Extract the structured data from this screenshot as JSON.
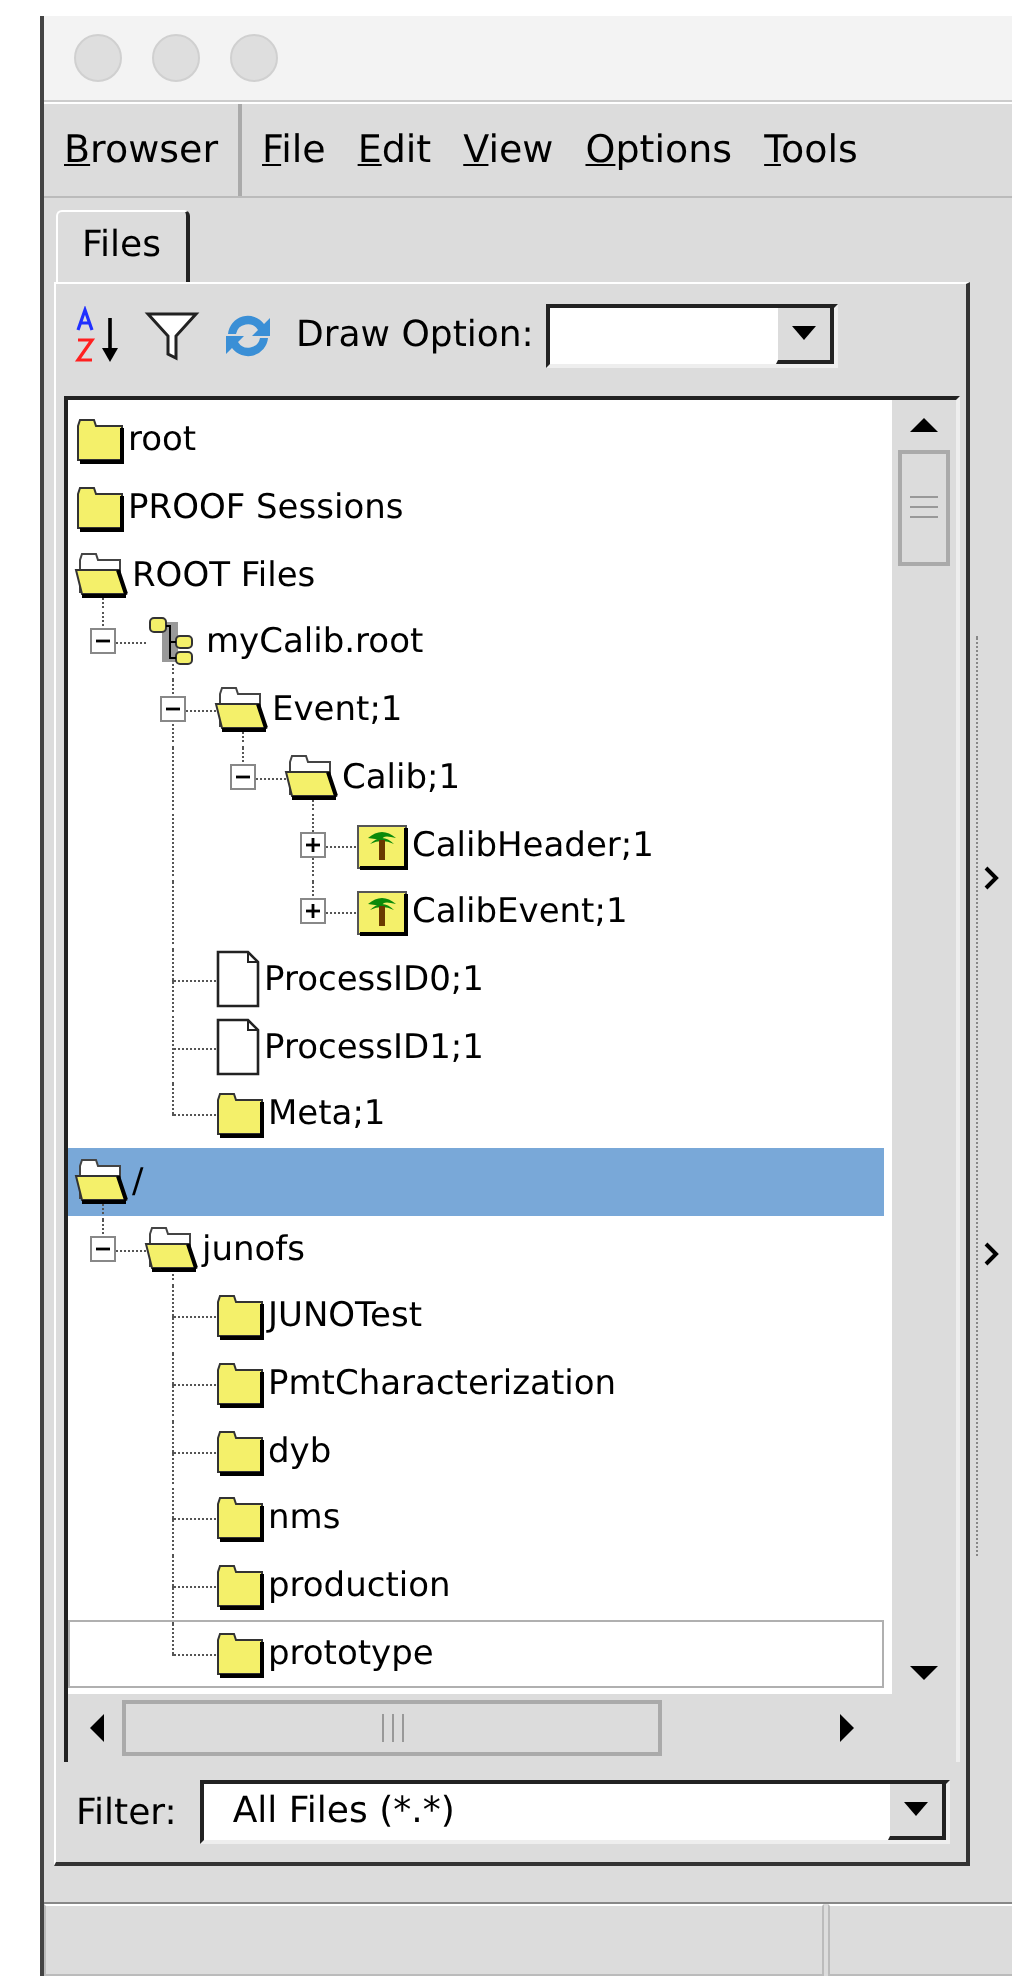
{
  "menu": [
    {
      "label": "Browser",
      "kind": "section"
    },
    {
      "label": "File",
      "kind": "item"
    },
    {
      "label": "Edit",
      "kind": "item"
    },
    {
      "label": "View",
      "kind": "item"
    },
    {
      "label": "Options",
      "kind": "item"
    },
    {
      "label": "Tools",
      "kind": "item"
    }
  ],
  "tabs": [
    {
      "label": "Files",
      "selected": true
    }
  ],
  "toolbar": {
    "draw_option_label": "Draw Option:"
  },
  "tree": {
    "items": [
      {
        "label": "root",
        "kind": "folder",
        "selected": false,
        "focused": false
      },
      {
        "label": "PROOF Sessions",
        "kind": "folder",
        "selected": false,
        "focused": false
      },
      {
        "label": "ROOT Files",
        "kind": "open-folder",
        "selected": false,
        "focused": false,
        "children": [
          {
            "label": "myCalib.root",
            "kind": "root-file",
            "expanded": true,
            "selected": false,
            "focused": false,
            "children": [
              {
                "label": "Event;1",
                "kind": "open-folder",
                "expanded": true,
                "selected": false,
                "focused": false,
                "children": [
                  {
                    "label": "Calib;1",
                    "kind": "open-folder",
                    "expanded": true,
                    "selected": false,
                    "focused": false,
                    "children": [
                      {
                        "label": "CalibHeader;1",
                        "kind": "tree",
                        "expanded": false,
                        "selected": false,
                        "focused": false
                      },
                      {
                        "label": "CalibEvent;1",
                        "kind": "tree",
                        "expanded": false,
                        "selected": false,
                        "focused": false
                      }
                    ]
                  }
                ]
              },
              {
                "label": "ProcessID0;1",
                "kind": "document",
                "selected": false,
                "focused": false
              },
              {
                "label": "ProcessID1;1",
                "kind": "document",
                "selected": false,
                "focused": false
              },
              {
                "label": "Meta;1",
                "kind": "folder",
                "selected": false,
                "focused": false
              }
            ]
          }
        ]
      },
      {
        "label": "/",
        "kind": "open-folder",
        "selected": true,
        "focused": false,
        "children": [
          {
            "label": "junofs",
            "kind": "open-folder",
            "expanded": true,
            "selected": false,
            "focused": false,
            "children": [
              {
                "label": "JUNOTest",
                "kind": "folder",
                "selected": false,
                "focused": false
              },
              {
                "label": "PmtCharacterization",
                "kind": "folder",
                "selected": false,
                "focused": false
              },
              {
                "label": "dyb",
                "kind": "folder",
                "selected": false,
                "focused": false
              },
              {
                "label": "nms",
                "kind": "folder",
                "selected": false,
                "focused": false
              },
              {
                "label": "production",
                "kind": "folder",
                "selected": false,
                "focused": false
              },
              {
                "label": "prototype",
                "kind": "folder",
                "selected": false,
                "focused": true
              }
            ]
          }
        ]
      }
    ]
  },
  "filter": {
    "label": "Filter:",
    "value": "All Files (*.*)"
  }
}
